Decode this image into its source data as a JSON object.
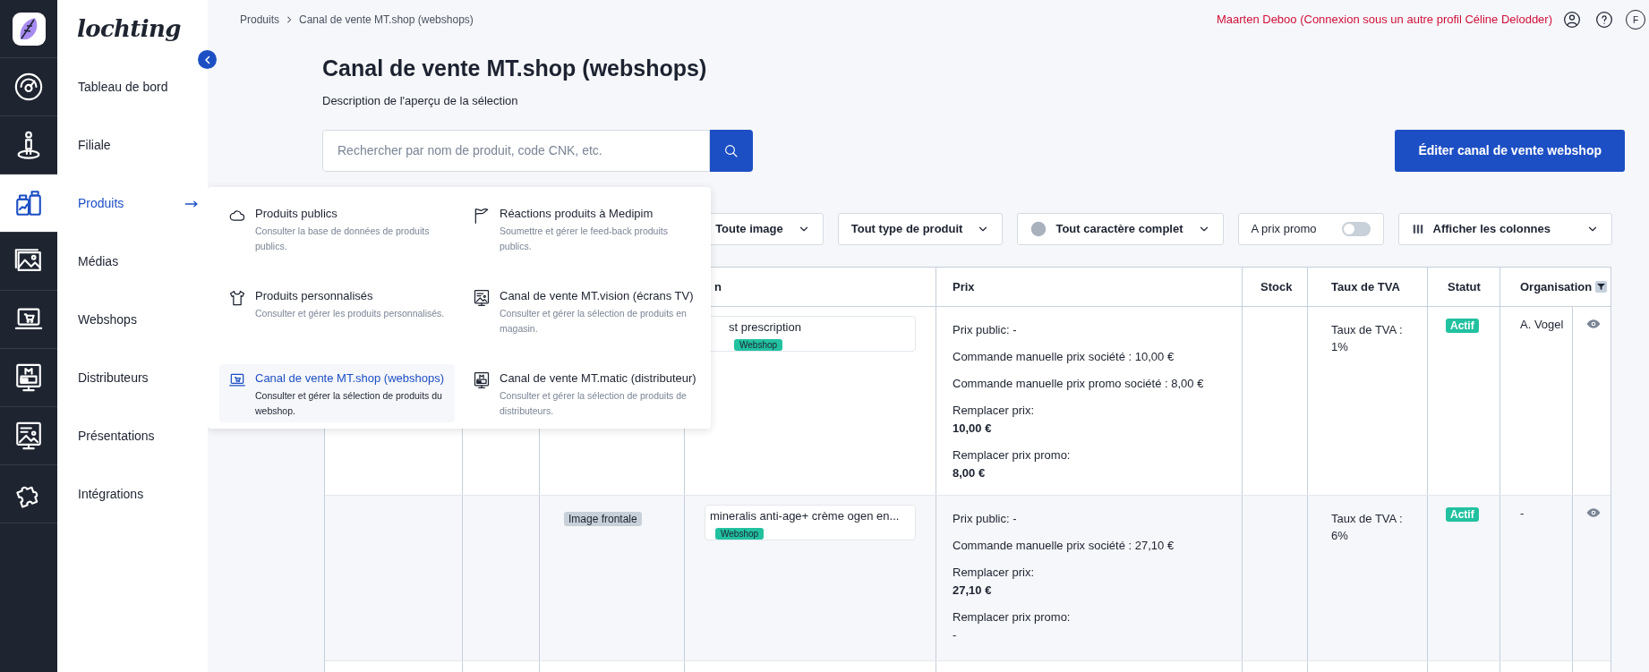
{
  "brand": "lochting",
  "sidebar": {
    "items": [
      {
        "label": "Tableau de bord",
        "kind": "gauge",
        "selected": false
      },
      {
        "label": "Filiale",
        "kind": "person",
        "selected": false
      },
      {
        "label": "Produits",
        "kind": "products",
        "selected": true
      },
      {
        "label": "Médias",
        "kind": "media",
        "selected": false
      },
      {
        "label": "Webshops",
        "kind": "webshop",
        "selected": false
      },
      {
        "label": "Distributeurs",
        "kind": "distributor",
        "selected": false
      },
      {
        "label": "Présentations",
        "kind": "presentation",
        "selected": false
      },
      {
        "label": "Intégrations",
        "kind": "puzzle",
        "selected": false
      }
    ]
  },
  "breadcrumb": [
    "Produits",
    "Canal de vente MT.shop (webshops)"
  ],
  "user_notice": "Maarten Deboo (Connexion sous un autre profil Céline Delodder)",
  "language": "F",
  "title": "Canal de vente MT.shop (webshops)",
  "description": "Description de l'aperçu de la sélection",
  "search": {
    "placeholder": "Rechercher par nom de produit, code CNK, etc."
  },
  "edit_button": "Éditer canal de vente webshop",
  "menu": {
    "items": [
      {
        "title": "Produits publics",
        "description": "Consulter la base de données de produits publics.",
        "kind": "cloud",
        "selected": false
      },
      {
        "title": "Réactions produits à Medipim",
        "description": "Soumettre et gérer le feed-back produits publics.",
        "kind": "flag",
        "selected": false
      },
      {
        "title": "Produits personnalisés",
        "description": "Consulter et gérer les produits personnalisés.",
        "kind": "shirt",
        "selected": false
      },
      {
        "title": "Canal de vente MT.vision (écrans TV)",
        "description": "Consulter et gérer la sélection de produits en magasin.",
        "kind": "presentation",
        "selected": false
      },
      {
        "title": "Canal de vente MT.shop (webshops)",
        "description": "Consulter et gérer la sélection de produits du webshop.",
        "kind": "webshop",
        "selected": true
      },
      {
        "title": "Canal de vente MT.matic (distributeur)",
        "description": "Consulter et gérer la sélection de produits de distributeurs.",
        "kind": "distributor",
        "selected": false
      }
    ]
  },
  "filters": [
    {
      "kind": "select",
      "label": "Toute image"
    },
    {
      "kind": "select",
      "label": "Tout type de produit"
    },
    {
      "kind": "select_dot",
      "label": "Tout caractère complet"
    },
    {
      "kind": "toggle",
      "label": "A prix promo",
      "on": false
    },
    {
      "kind": "columns",
      "label": "Afficher les colonnes"
    }
  ],
  "table": {
    "columns": [
      "n",
      "Prix",
      "Stock",
      "Taux de TVA",
      "Statut",
      "Organisation"
    ],
    "rows": [
      {
        "image_tag": null,
        "name": "st prescription",
        "covered": true,
        "tag": "Webshop",
        "prices": [
          {
            "kind": "inline",
            "text": "Prix public: -"
          },
          {
            "kind": "inline",
            "text": "Commande manuelle prix société : 10,00 €"
          },
          {
            "kind": "inline",
            "text": "Commande manuelle prix promo société : 8,00 €"
          },
          {
            "kind": "block",
            "text": "Remplacer prix:",
            "value": "10,00 €",
            "value_bold": true
          },
          {
            "kind": "block",
            "text": "Remplacer prix promo:",
            "value": "8,00 €",
            "value_bold": true
          }
        ],
        "vat": "Taux de TVA : 1%",
        "status": "Actif",
        "organisation": "A. Vogel"
      },
      {
        "image_tag": "Image frontale",
        "name": "mineralis anti-age+ crème ogen en...",
        "covered": false,
        "tag": "Webshop",
        "prices": [
          {
            "kind": "inline",
            "text": "Prix public: -"
          },
          {
            "kind": "inline",
            "text": "Commande manuelle prix société : 27,10 €"
          },
          {
            "kind": "block",
            "text": "Remplacer prix:",
            "value": "27,10 €",
            "value_bold": true
          },
          {
            "kind": "block",
            "text": "Remplacer prix promo:",
            "value": "-",
            "value_bold": false
          }
        ],
        "vat": "Taux de TVA : 6%",
        "status": "Actif",
        "organisation": "-"
      }
    ]
  }
}
